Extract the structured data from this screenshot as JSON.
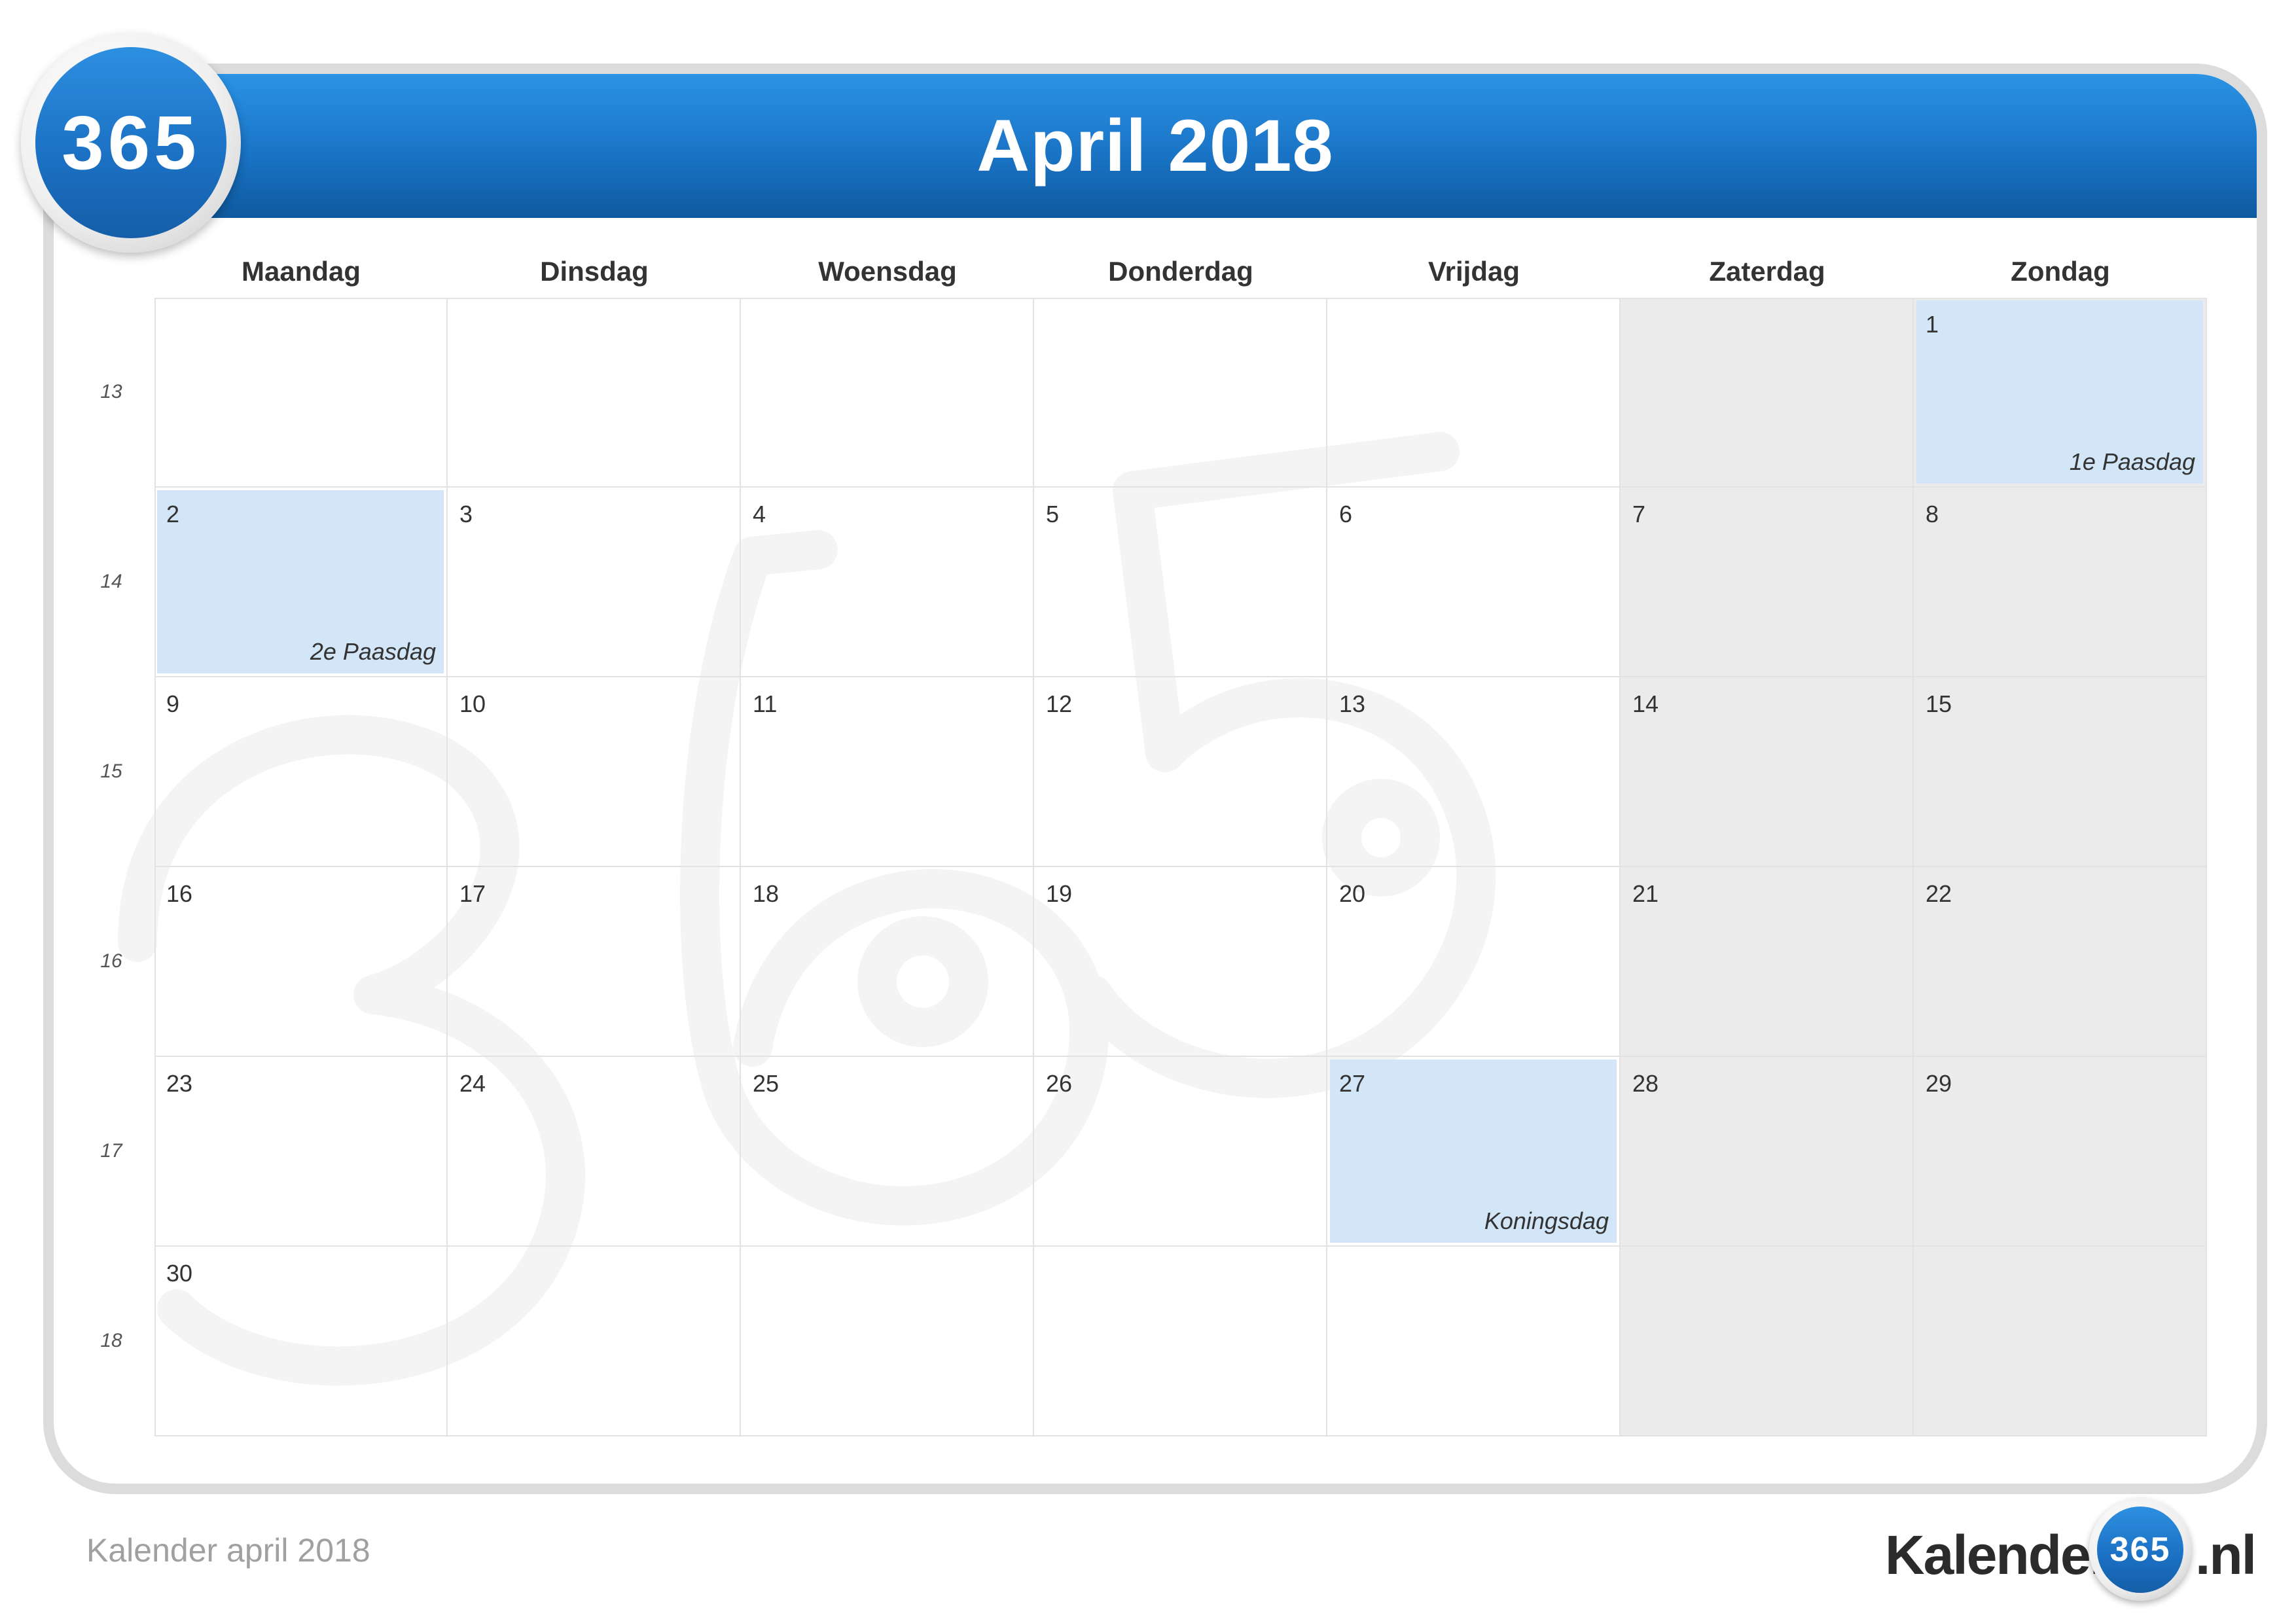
{
  "header": {
    "title": "April 2018",
    "badge": "365"
  },
  "weekdays": [
    "Maandag",
    "Dinsdag",
    "Woensdag",
    "Donderdag",
    "Vrijdag",
    "Zaterdag",
    "Zondag"
  ],
  "week_numbers": [
    "13",
    "14",
    "15",
    "16",
    "17",
    "18"
  ],
  "weeks": [
    [
      null,
      null,
      null,
      null,
      null,
      null,
      "1"
    ],
    [
      "2",
      "3",
      "4",
      "5",
      "6",
      "7",
      "8"
    ],
    [
      "9",
      "10",
      "11",
      "12",
      "13",
      "14",
      "15"
    ],
    [
      "16",
      "17",
      "18",
      "19",
      "20",
      "21",
      "22"
    ],
    [
      "23",
      "24",
      "25",
      "26",
      "27",
      "28",
      "29"
    ],
    [
      "30",
      null,
      null,
      null,
      null,
      null,
      null
    ]
  ],
  "holidays": {
    "1": "1e Paasdag",
    "2": "2e Paasdag",
    "27": "Koningsdag"
  },
  "footer": {
    "caption": "Kalender april 2018",
    "logo_text": "Kalender",
    "logo_badge": "365",
    "logo_suffix": ".nl"
  },
  "colors": {
    "header_blue": "#1a74c6",
    "holiday_fill": "#d2e6f8",
    "weekend_fill": "#e8e8e8"
  }
}
